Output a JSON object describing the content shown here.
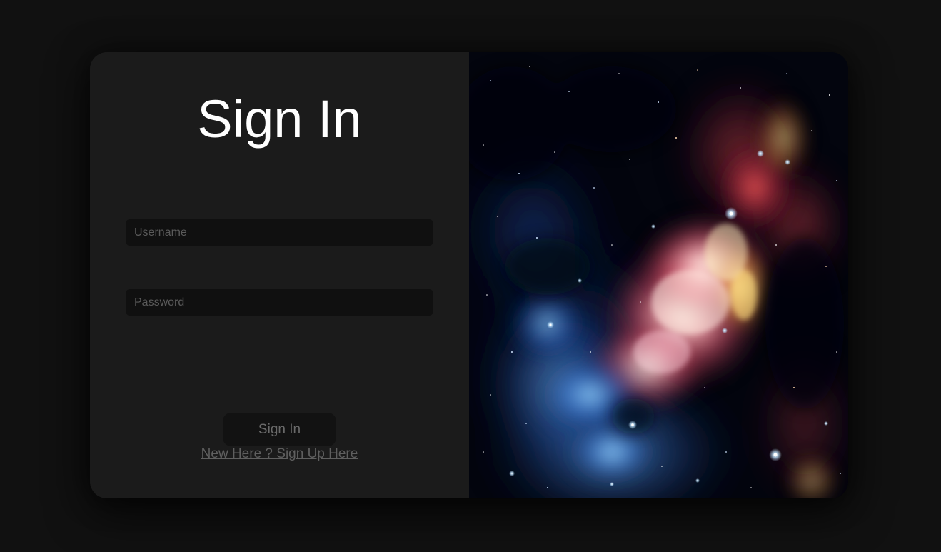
{
  "signin": {
    "title": "Sign In",
    "username_placeholder": "Username",
    "password_placeholder": "Password",
    "button_label": "Sign In",
    "signup_link": "New Here ? Sign Up Here"
  },
  "colors": {
    "page_background": "#111111",
    "card_background": "#1b1b1b",
    "input_background": "#101010",
    "button_background": "#121212",
    "title_color": "#ffffff",
    "link_color": "#5f5f5f"
  },
  "image": {
    "subject": "galaxy-nebula-image"
  }
}
